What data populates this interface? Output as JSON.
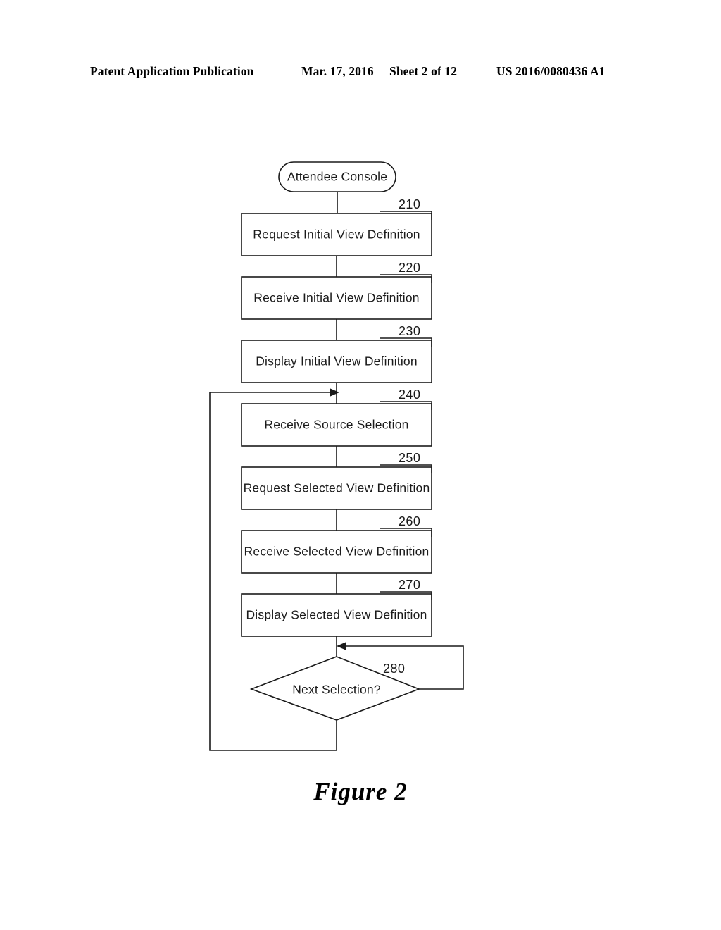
{
  "header": {
    "publication": "Patent Application Publication",
    "date": "Mar. 17, 2016",
    "sheet": "Sheet 2 of 12",
    "patent_number": "US 2016/0080436 A1"
  },
  "figure": {
    "caption": "Figure 2",
    "type": "flowchart",
    "start_node": {
      "label": "Attendee Console",
      "shape": "rounded-terminator"
    },
    "steps": [
      {
        "ref": "210",
        "label": "Request Initial View Definition",
        "shape": "process"
      },
      {
        "ref": "220",
        "label": "Receive Initial View Definition",
        "shape": "process"
      },
      {
        "ref": "230",
        "label": "Display Initial View Definition",
        "shape": "process"
      },
      {
        "ref": "240",
        "label": "Receive Source Selection",
        "shape": "process"
      },
      {
        "ref": "250",
        "label": "Request Selected View Definition",
        "shape": "process"
      },
      {
        "ref": "260",
        "label": "Receive Selected View Definition",
        "shape": "process"
      },
      {
        "ref": "270",
        "label": "Display Selected View Definition",
        "shape": "process"
      }
    ],
    "decision": {
      "ref": "280",
      "label": "Next Selection?",
      "shape": "diamond"
    }
  },
  "colors": {
    "ink": "#1a1a1a",
    "paper": "#ffffff"
  }
}
